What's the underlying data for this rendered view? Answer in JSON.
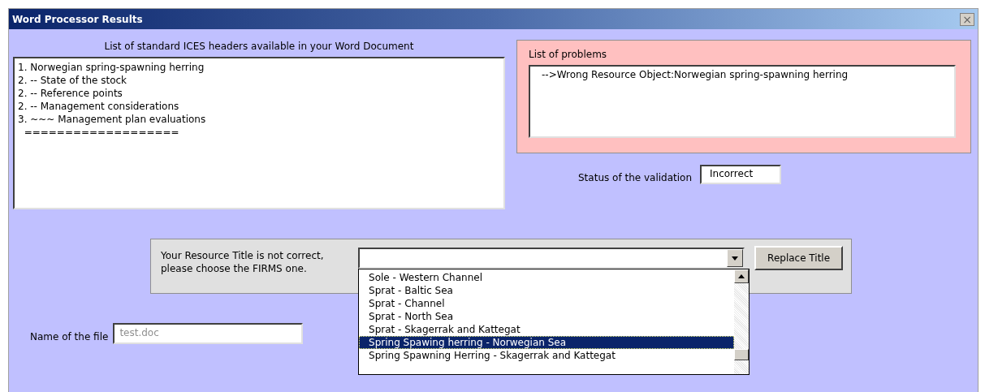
{
  "window": {
    "title": "Word Processor Results",
    "close": "×"
  },
  "headers": {
    "label": "List of standard ICES headers available in your Word Document",
    "lines": [
      "1. Norwegian spring-spawning herring",
      "2. -- State of the stock",
      "2. -- Reference points",
      "2. -- Management considerations",
      "3. ~~~ Management plan evaluations",
      "  ==================="
    ]
  },
  "problems": {
    "label": "List of problems",
    "lines": [
      "-->Wrong Resource Object:Norwegian spring-spawning herring"
    ]
  },
  "validation": {
    "label": "Status of the validation",
    "value": "Incorrect"
  },
  "title_choice": {
    "label": "Your Resource Title is not correct,\nplease choose the FIRMS one.",
    "button": "Replace Title",
    "expanded": true,
    "options": [
      {
        "label": "Sole - Western Channel",
        "selected": false
      },
      {
        "label": "Sprat - Baltic Sea",
        "selected": false
      },
      {
        "label": "Sprat - Channel",
        "selected": false
      },
      {
        "label": "Sprat - North Sea",
        "selected": false
      },
      {
        "label": "Sprat - Skagerrak and Kattegat",
        "selected": false
      },
      {
        "label": "Spring Spawing herring - Norwegian Sea",
        "selected": true
      },
      {
        "label": "Spring Spawning Herring - Skagerrak and Kattegat",
        "selected": false
      }
    ]
  },
  "file": {
    "label": "Name of the file",
    "value": "test.doc",
    "disabled": true
  }
}
